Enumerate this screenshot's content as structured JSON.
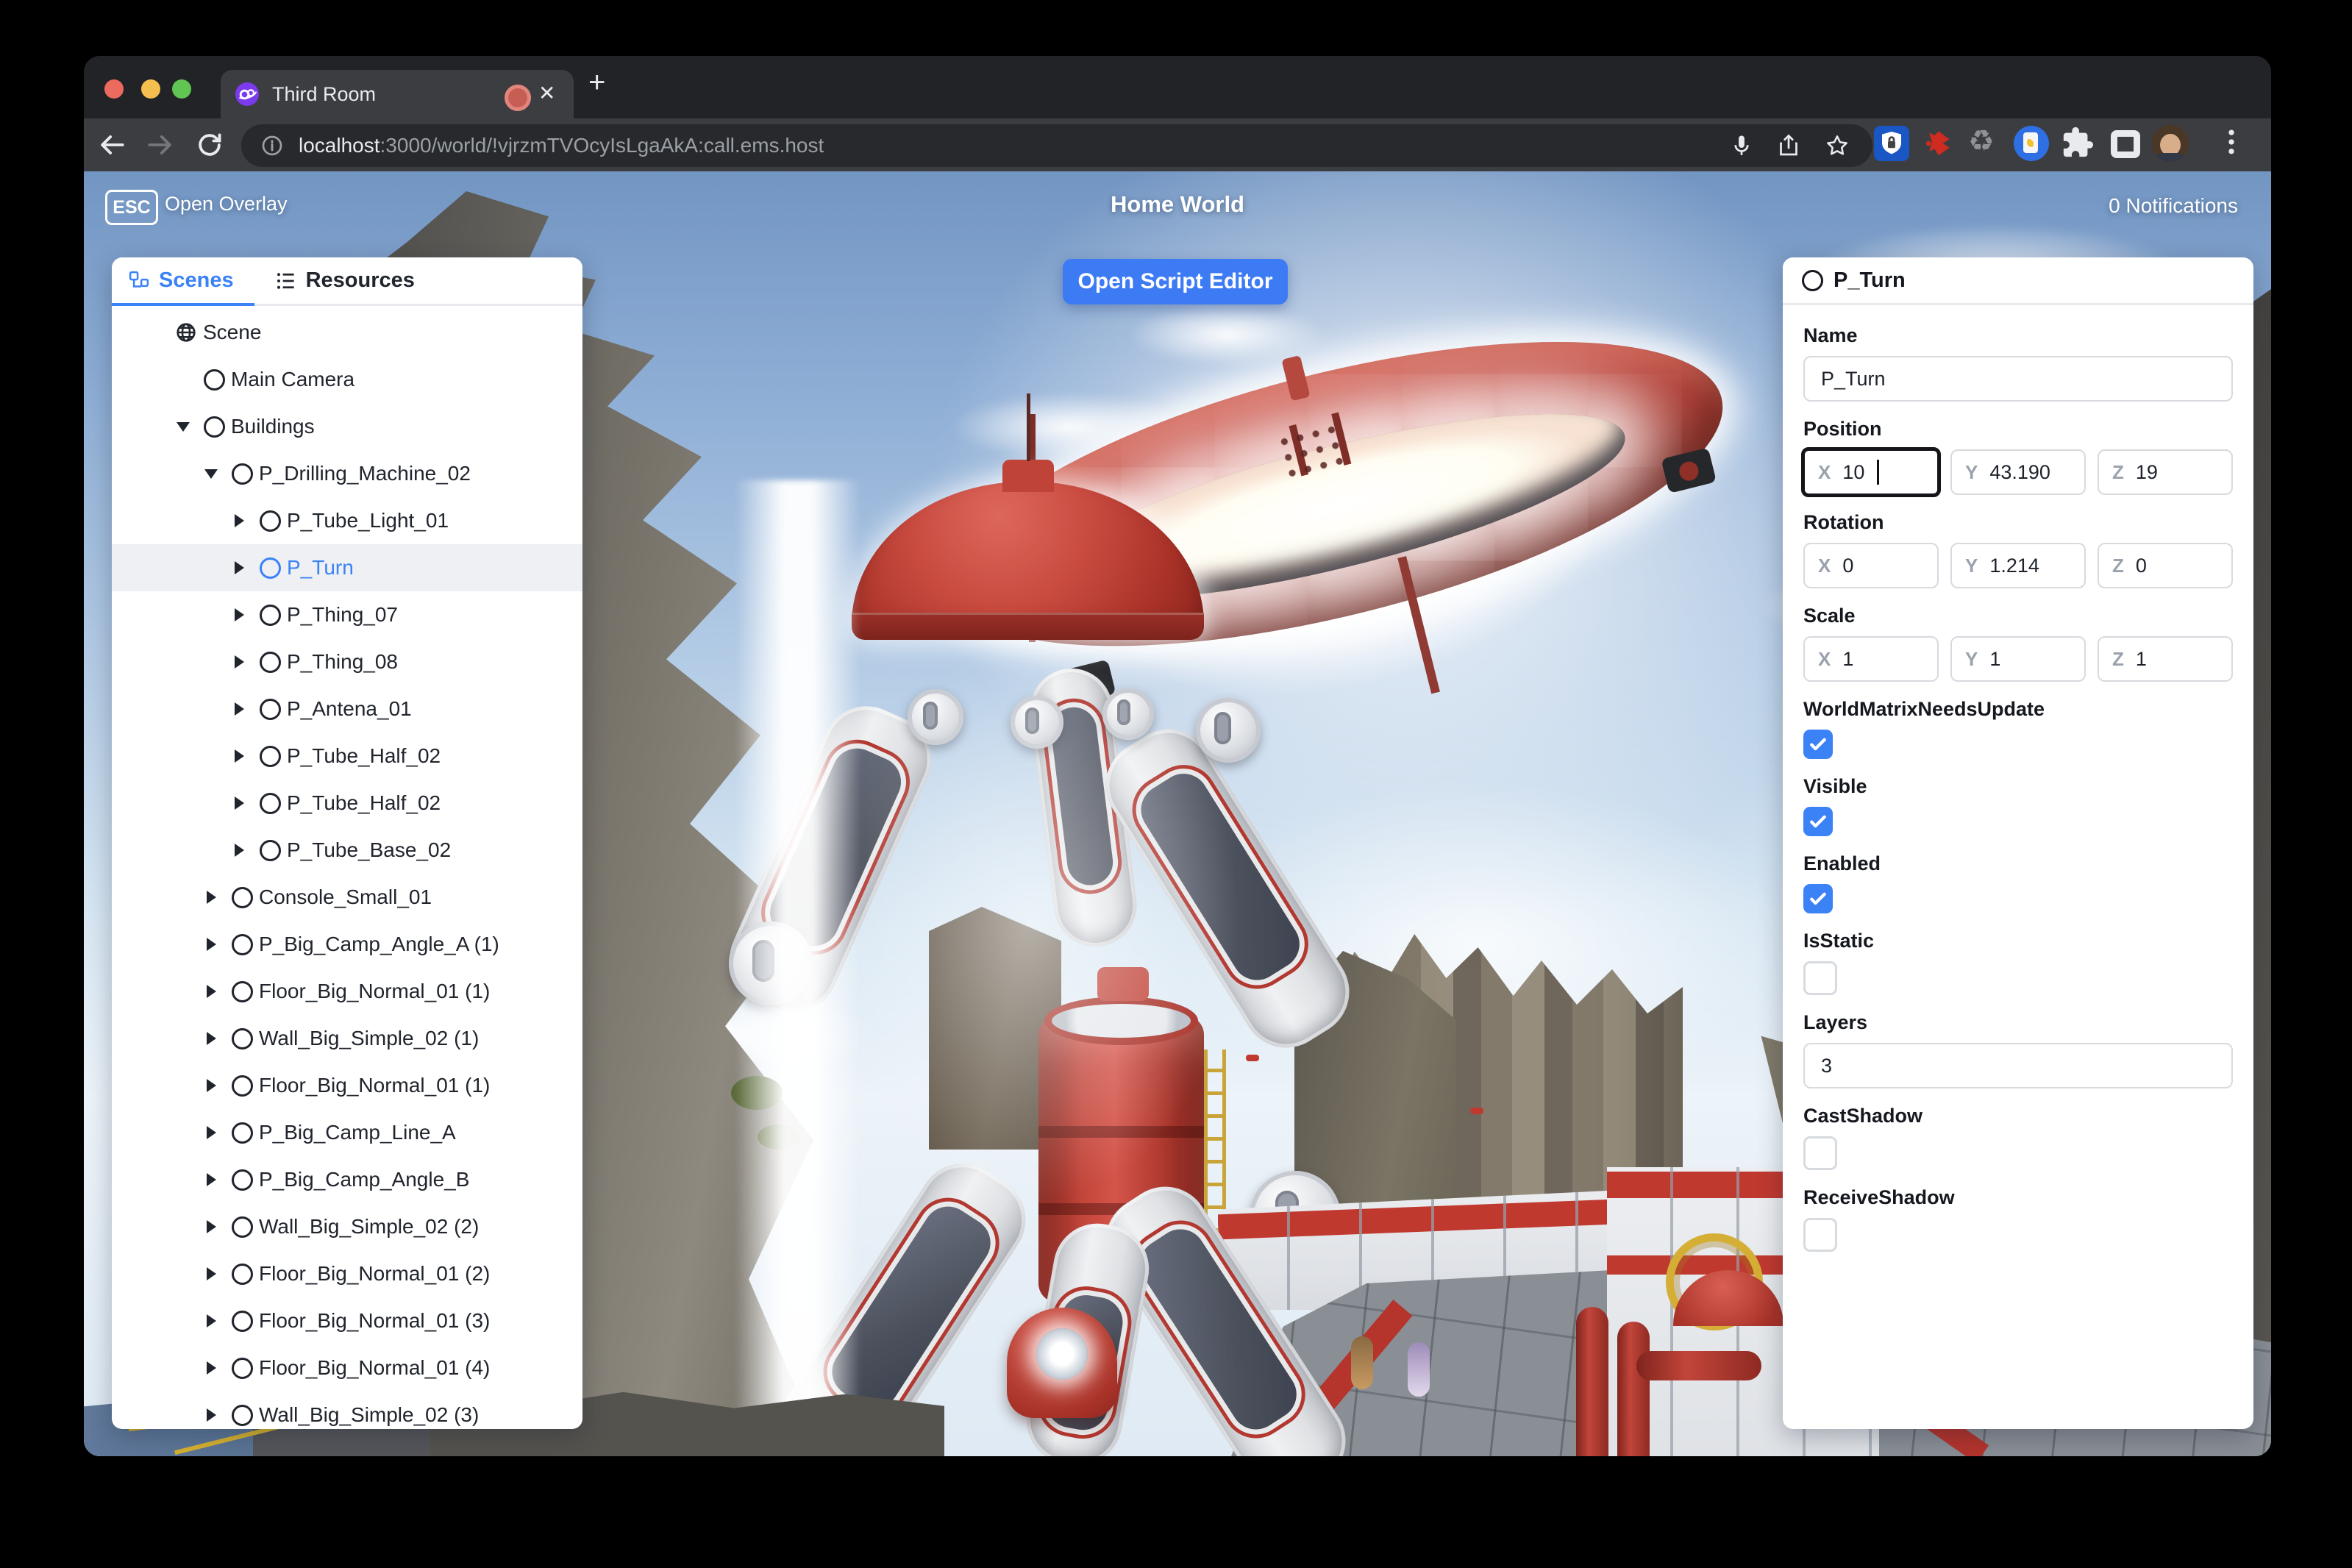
{
  "browser": {
    "tab_title": "Third Room",
    "url_host": "localhost",
    "url_rest": ":3000/world/!vjrzmTVOcyIsLgaAkA:call.ems.host"
  },
  "overlay": {
    "esc_key": "ESC",
    "open_overlay_label": "Open Overlay",
    "world_title": "Home World",
    "notifications_label": "0 Notifications",
    "open_script_editor_label": "Open Script Editor"
  },
  "left_panel": {
    "tabs": [
      {
        "label": "Scenes",
        "active": true
      },
      {
        "label": "Resources",
        "active": false
      }
    ],
    "tree": [
      {
        "label": "Scene",
        "icon": "globe",
        "indent": 0,
        "caret": null,
        "selected": false
      },
      {
        "label": "Main Camera",
        "icon": "circle",
        "indent": 1,
        "caret": null,
        "selected": false
      },
      {
        "label": "Buildings",
        "icon": "circle",
        "indent": 1,
        "caret": "down",
        "selected": false
      },
      {
        "label": "P_Drilling_Machine_02",
        "icon": "circle",
        "indent": 2,
        "caret": "down",
        "selected": false
      },
      {
        "label": "P_Tube_Light_01",
        "icon": "circle",
        "indent": 3,
        "caret": "right",
        "selected": false
      },
      {
        "label": "P_Turn",
        "icon": "circle",
        "indent": 3,
        "caret": "right",
        "selected": true
      },
      {
        "label": "P_Thing_07",
        "icon": "circle",
        "indent": 3,
        "caret": "right",
        "selected": false
      },
      {
        "label": "P_Thing_08",
        "icon": "circle",
        "indent": 3,
        "caret": "right",
        "selected": false
      },
      {
        "label": "P_Antena_01",
        "icon": "circle",
        "indent": 3,
        "caret": "right",
        "selected": false
      },
      {
        "label": "P_Tube_Half_02",
        "icon": "circle",
        "indent": 3,
        "caret": "right",
        "selected": false
      },
      {
        "label": "P_Tube_Half_02",
        "icon": "circle",
        "indent": 3,
        "caret": "right",
        "selected": false
      },
      {
        "label": "P_Tube_Base_02",
        "icon": "circle",
        "indent": 3,
        "caret": "right",
        "selected": false
      },
      {
        "label": "Console_Small_01",
        "icon": "circle",
        "indent": 2,
        "caret": "right",
        "selected": false
      },
      {
        "label": "P_Big_Camp_Angle_A (1)",
        "icon": "circle",
        "indent": 2,
        "caret": "right",
        "selected": false
      },
      {
        "label": "Floor_Big_Normal_01 (1)",
        "icon": "circle",
        "indent": 2,
        "caret": "right",
        "selected": false
      },
      {
        "label": "Wall_Big_Simple_02 (1)",
        "icon": "circle",
        "indent": 2,
        "caret": "right",
        "selected": false
      },
      {
        "label": "Floor_Big_Normal_01 (1)",
        "icon": "circle",
        "indent": 2,
        "caret": "right",
        "selected": false
      },
      {
        "label": "P_Big_Camp_Line_A",
        "icon": "circle",
        "indent": 2,
        "caret": "right",
        "selected": false
      },
      {
        "label": "P_Big_Camp_Angle_B",
        "icon": "circle",
        "indent": 2,
        "caret": "right",
        "selected": false
      },
      {
        "label": "Wall_Big_Simple_02 (2)",
        "icon": "circle",
        "indent": 2,
        "caret": "right",
        "selected": false
      },
      {
        "label": "Floor_Big_Normal_01 (2)",
        "icon": "circle",
        "indent": 2,
        "caret": "right",
        "selected": false
      },
      {
        "label": "Floor_Big_Normal_01 (3)",
        "icon": "circle",
        "indent": 2,
        "caret": "right",
        "selected": false
      },
      {
        "label": "Floor_Big_Normal_01 (4)",
        "icon": "circle",
        "indent": 2,
        "caret": "right",
        "selected": false
      },
      {
        "label": "Wall_Big_Simple_02 (3)",
        "icon": "circle",
        "indent": 2,
        "caret": "right",
        "selected": false
      }
    ]
  },
  "right_panel": {
    "title": "P_Turn",
    "axis_labels": {
      "x": "X",
      "y": "Y",
      "z": "Z"
    },
    "sections": [
      {
        "type": "input",
        "label": "Name",
        "value": "P_Turn"
      },
      {
        "type": "vec3",
        "label": "Position",
        "x": "10",
        "y": "43.190",
        "z": "19",
        "focused": "x"
      },
      {
        "type": "vec3",
        "label": "Rotation",
        "x": "0",
        "y": "1.214",
        "z": "0",
        "focused": null
      },
      {
        "type": "vec3",
        "label": "Scale",
        "x": "1",
        "y": "1",
        "z": "1",
        "focused": null
      },
      {
        "type": "checkbox",
        "label": "WorldMatrixNeedsUpdate",
        "checked": true
      },
      {
        "type": "checkbox",
        "label": "Visible",
        "checked": true
      },
      {
        "type": "checkbox",
        "label": "Enabled",
        "checked": true
      },
      {
        "type": "checkbox",
        "label": "IsStatic",
        "checked": false
      },
      {
        "type": "input",
        "label": "Layers",
        "value": "3"
      },
      {
        "type": "checkbox",
        "label": "CastShadow",
        "checked": false
      },
      {
        "type": "checkbox",
        "label": "ReceiveShadow",
        "checked": false
      }
    ]
  },
  "colors": {
    "accent_blue": "#3b82f6",
    "button_blue": "#3d7bf5",
    "selection_bg": "#eef0f3",
    "machine_red": "#b5342c",
    "chrome_dark": "#222326",
    "chrome_toolbar": "#3c3d41"
  }
}
